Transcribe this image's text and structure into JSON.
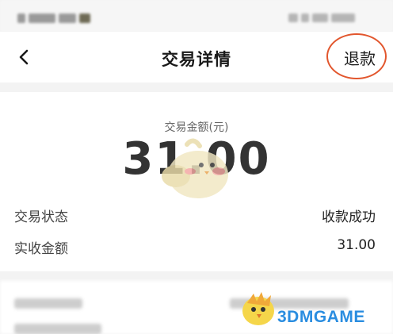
{
  "nav": {
    "title": "交易详情",
    "refund_label": "退款",
    "highlight_color": "#e2562d"
  },
  "icons": {
    "back": "chevron-left-icon",
    "mascot": "chick-mascot-icon",
    "watermark": "3dmgame-logo-icon"
  },
  "amount": {
    "label": "交易金额(元)",
    "value": "31.00"
  },
  "details": [
    {
      "label": "交易状态",
      "value": "收款成功"
    },
    {
      "label": "实收金额",
      "value": "31.00"
    }
  ],
  "watermark": {
    "text": "3DMGAME",
    "color": "#2a8de0"
  }
}
